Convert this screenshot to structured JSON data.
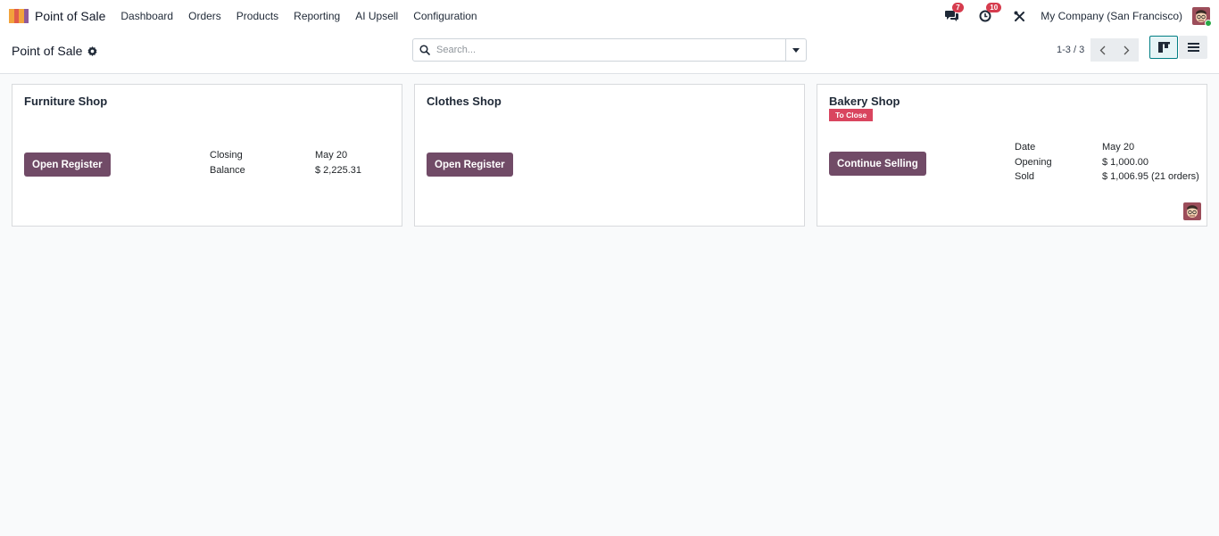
{
  "navbar": {
    "app_name": "Point of Sale",
    "menu": [
      "Dashboard",
      "Orders",
      "Products",
      "Reporting",
      "AI Upsell",
      "Configuration"
    ],
    "messages_count": "7",
    "activities_count": "10",
    "company": "My Company (San Francisco)"
  },
  "control_panel": {
    "title": "Point of Sale",
    "search_placeholder": "Search...",
    "pager": "1-3 / 3"
  },
  "cards": {
    "furniture": {
      "title": "Furniture Shop",
      "button": "Open Register",
      "stats": [
        {
          "label": "Closing",
          "value": "May 20"
        },
        {
          "label": "Balance",
          "value": "$ 2,225.31"
        }
      ]
    },
    "clothes": {
      "title": "Clothes Shop",
      "button": "Open Register"
    },
    "bakery": {
      "title": "Bakery Shop",
      "status_tag": "To Close",
      "button": "Continue Selling",
      "stats": [
        {
          "label": "Date",
          "value": "May 20"
        },
        {
          "label": "Opening",
          "value": "$ 1,000.00"
        },
        {
          "label": "Sold",
          "value": "$ 1,006.95 (21 orders)"
        }
      ]
    }
  },
  "colors": {
    "primary": "#714b67",
    "badge": "#d63c4e",
    "tag_to_close": "#d9455f",
    "accent": "#017e84"
  },
  "icons": {
    "app": "pos-app-icon",
    "messages": "chat-bubbles-icon",
    "activities": "clock-icon",
    "debug": "tools-icon",
    "settings": "gear-icon",
    "search": "search-icon",
    "search_toggle": "caret-down-icon",
    "pager_prev": "chevron-left-icon",
    "pager_next": "chevron-right-icon",
    "kanban_view": "kanban-icon",
    "list_view": "list-icon"
  }
}
